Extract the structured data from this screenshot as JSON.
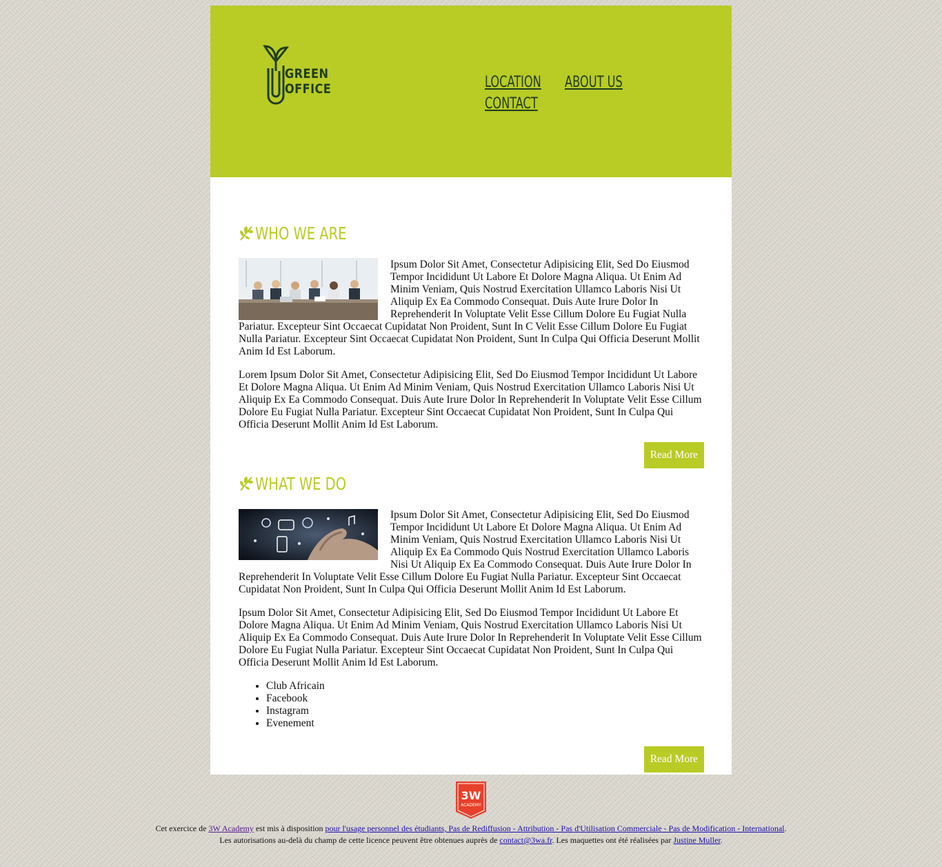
{
  "header": {
    "logo": {
      "line1": "GREEN",
      "line2": "OFFICE",
      "icon": "paperclip-sprout-logo"
    },
    "nav": [
      {
        "label": "LOCATION"
      },
      {
        "label": "ABOUT US"
      },
      {
        "label": "CONTACT"
      }
    ]
  },
  "sections": [
    {
      "title": "WHO WE ARE",
      "icon": "leaf-icon",
      "image": "team-meeting-photo",
      "para1": "Ipsum Dolor Sit Amet, Consectetur Adipisicing Elit, Sed Do Eiusmod Tempor Incididunt Ut Labore Et Dolore Magna Aliqua. Ut Enim Ad Minim Veniam, Quis Nostrud Exercitation Ullamco Laboris Nisi Ut Aliquip Ex Ea Commodo Consequat. Duis Aute Irure Dolor In Reprehenderit In Voluptate Velit Esse Cillum Dolore Eu Fugiat Nulla Pariatur. Excepteur Sint Occaecat Cupidatat Non Proident, Sunt In C Velit Esse Cillum Dolore Eu Fugiat Nulla Pariatur. Excepteur Sint Occaecat Cupidatat Non Proident, Sunt In Culpa Qui Officia Deserunt Mollit Anim Id Est Laborum.",
      "para2": "Lorem Ipsum Dolor Sit Amet, Consectetur Adipisicing Elit, Sed Do Eiusmod Tempor Incididunt Ut Labore Et Dolore Magna Aliqua. Ut Enim Ad Minim Veniam, Quis Nostrud Exercitation Ullamco Laboris Nisi Ut Aliquip Ex Ea Commodo Consequat. Duis Aute Irure Dolor In Reprehenderit In Voluptate Velit Esse Cillum Dolore Eu Fugiat Nulla Pariatur. Excepteur Sint Occaecat Cupidatat Non Proident, Sunt In Culpa Qui Officia Deserunt Mollit Anim Id Est Laborum.",
      "button": "Read More"
    },
    {
      "title": "WHAT WE DO",
      "icon": "leaf-icon",
      "image": "touch-technology-photo",
      "para1": "Ipsum Dolor Sit Amet, Consectetur Adipisicing Elit, Sed Do Eiusmod Tempor Incididunt Ut Labore Et Dolore Magna Aliqua. Ut Enim Ad Minim Veniam, Quis Nostrud Exercitation Ullamco Laboris Nisi Ut Aliquip Ex Ea Commodo Quis Nostrud Exercitation Ullamco Laboris Nisi Ut Aliquip Ex Ea Commodo Consequat. Duis Aute Irure Dolor In Reprehenderit In Voluptate Velit Esse Cillum Dolore Eu Fugiat Nulla Pariatur. Excepteur Sint Occaecat Cupidatat Non Proident, Sunt In Culpa Qui Officia Deserunt Mollit Anim Id Est Laborum.",
      "para2": "Ipsum Dolor Sit Amet, Consectetur Adipisicing Elit, Sed Do Eiusmod Tempor Incididunt Ut Labore Et Dolore Magna Aliqua. Ut Enim Ad Minim Veniam, Quis Nostrud Exercitation Ullamco Laboris Nisi Ut Aliquip Ex Ea Commodo Consequat. Duis Aute Irure Dolor In Reprehenderit In Voluptate Velit Esse Cillum Dolore Eu Fugiat Nulla Pariatur. Excepteur Sint Occaecat Cupidatat Non Proident, Sunt In Culpa Qui Officia Deserunt Mollit Anim Id Est Laborum.",
      "list": [
        "Club Africain",
        "Facebook",
        "Instagram",
        "Evenement"
      ],
      "button": "Read More"
    }
  ],
  "footer": {
    "badge": {
      "text1": "3W",
      "text2": "ACADEMY"
    },
    "line1_a": "Cet exercice de ",
    "academy_link": "3W Academy",
    "line1_b": " est mis à disposition ",
    "license_link": "pour l'usage personnel des étudiants, Pas de Rediffusion - Attribution - Pas d'Utilisation Commerciale - Pas de Modification - International",
    "line1_c": ".",
    "line2_a": "Les autorisations au-delà du champ de cette licence peuvent être obtenues auprès de ",
    "email_link": "contact@3wa.fr",
    "line2_b": ". Les maquettes ont été réalisées par ",
    "author_link": "Justine Muller",
    "line2_c": "."
  },
  "colors": {
    "brand": "#b9cb25",
    "dark_green": "#1f3d1f",
    "badge_red": "#e8402a",
    "link": "#1a0dab"
  }
}
